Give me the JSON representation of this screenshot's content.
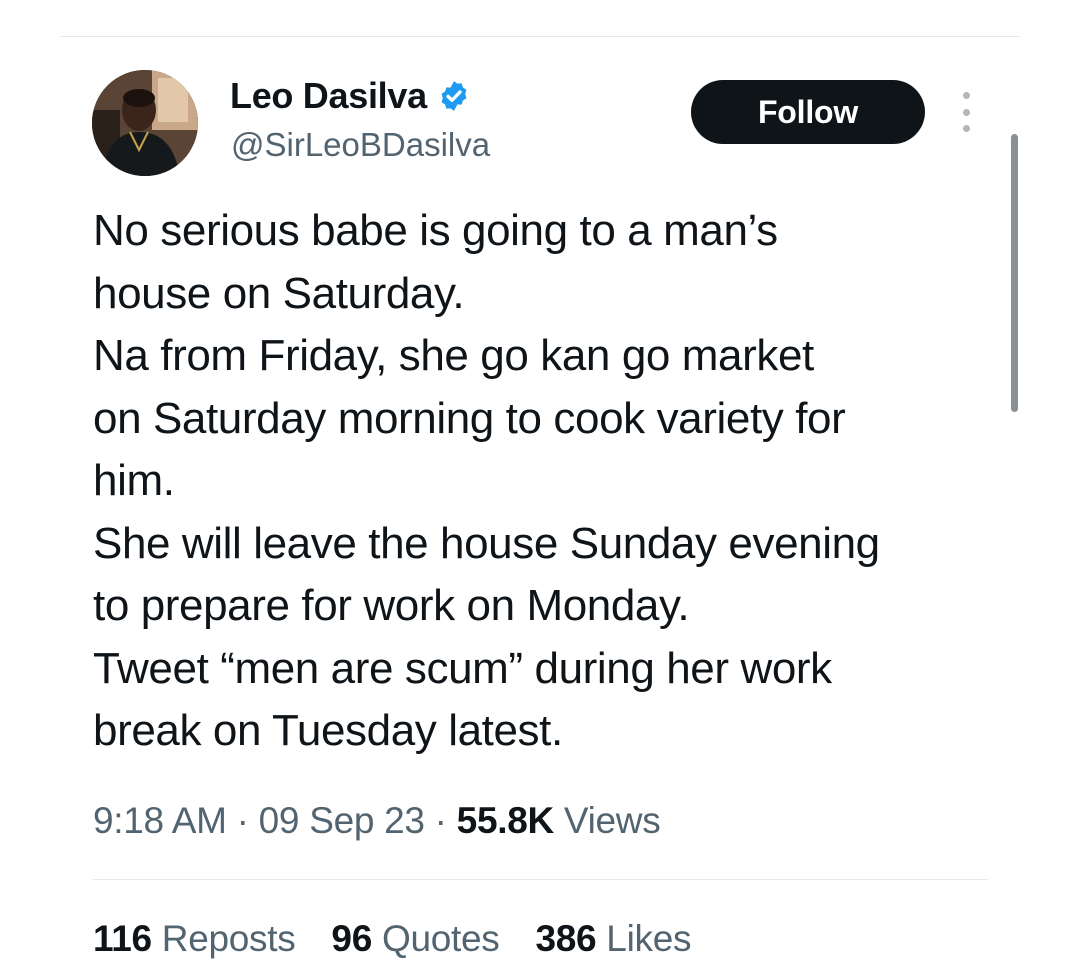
{
  "author": {
    "name": "Leo Dasilva",
    "handle": "@SirLeoBDasilva",
    "verified_color": "#1d9bf0"
  },
  "actions": {
    "follow_label": "Follow",
    "more_icon": "more-vertical-icon"
  },
  "tweet": {
    "lines": [
      "No serious babe is going to a man’s",
      "house on Saturday.",
      "Na from Friday, she go kan go market",
      "on Saturday morning to cook variety for",
      "him.",
      "She will leave the house Sunday evening",
      "to prepare for work on Monday.",
      "Tweet “men are scum” during her work",
      "break on Tuesday latest."
    ]
  },
  "meta": {
    "time": "9:18 AM",
    "separator": "·",
    "date": "09 Sep 23",
    "views_count": "55.8K",
    "views_label": "Views"
  },
  "stats": {
    "reposts_count": "116",
    "reposts_label": "Reposts",
    "quotes_count": "96",
    "quotes_label": "Quotes",
    "likes_count": "386",
    "likes_label": "Likes"
  },
  "colors": {
    "text_primary": "#0f1419",
    "text_secondary": "#536471",
    "follow_bg": "#0f1419",
    "divider": "#e6e9eb"
  }
}
